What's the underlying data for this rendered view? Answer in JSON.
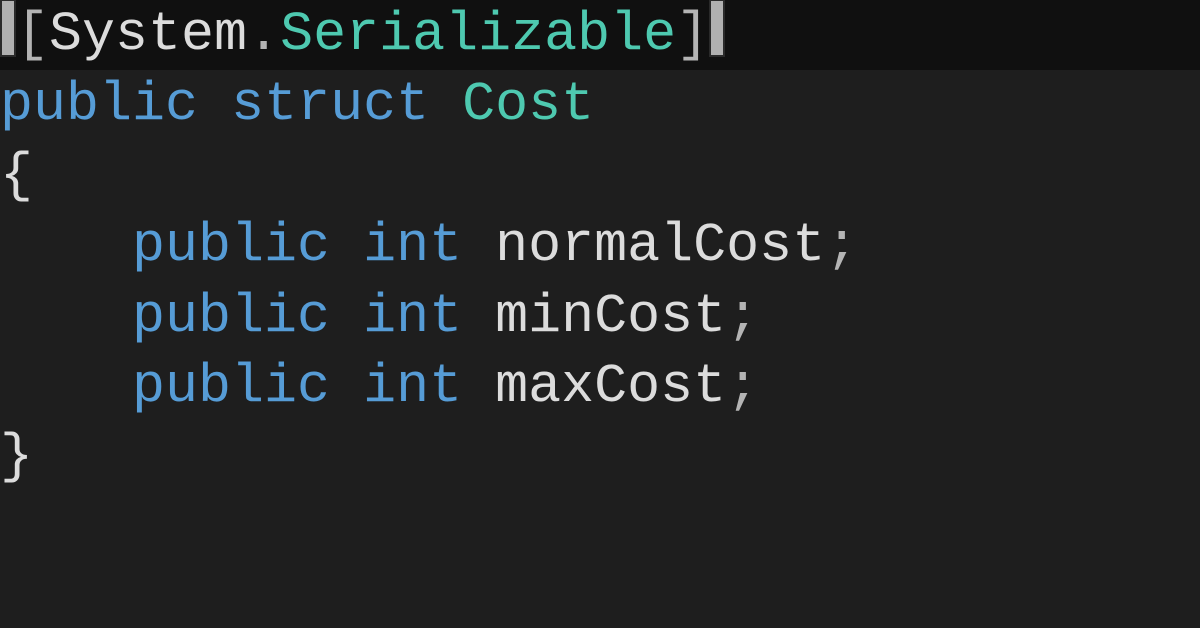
{
  "code": {
    "line1": {
      "open_bracket": "[",
      "namespace": "System",
      "dot": ".",
      "attr": "Serializable",
      "close_bracket": "]"
    },
    "line2": {
      "kw_public": "public",
      "kw_struct": "struct",
      "typename": "Cost"
    },
    "line3": {
      "brace": "{"
    },
    "line4": {
      "text": ""
    },
    "line5": {
      "indent": "    ",
      "kw_public": "public",
      "kw_type": "int",
      "ident": "normalCost",
      "semi": ";"
    },
    "line6": {
      "indent": "    ",
      "kw_public": "public",
      "kw_type": "int",
      "ident": "minCost",
      "semi": ";"
    },
    "line7": {
      "indent": "    ",
      "kw_public": "public",
      "kw_type": "int",
      "ident": "maxCost",
      "semi": ";"
    },
    "line8": {
      "text": ""
    },
    "line9": {
      "brace": "}"
    }
  },
  "space": " "
}
